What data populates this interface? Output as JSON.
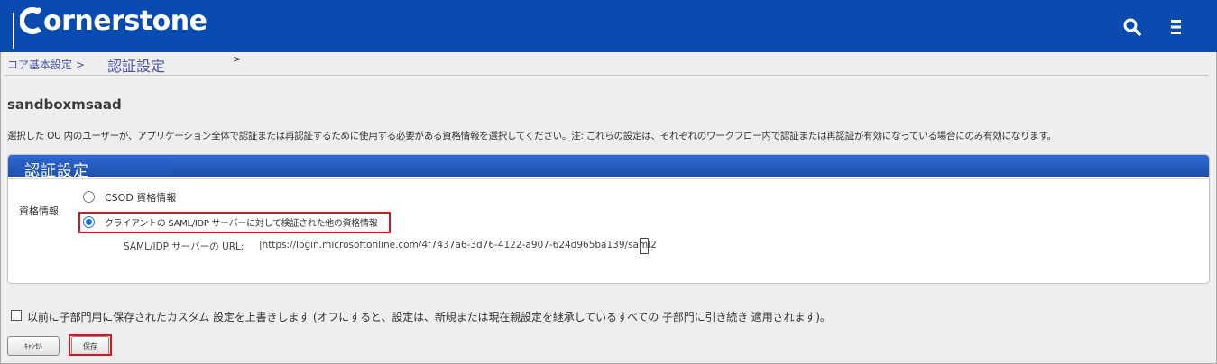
{
  "header": {
    "logo_text": "ornerstone",
    "brand_color": "#0a4bb0",
    "icons": [
      "search-icon",
      "hamburger-menu-icon"
    ]
  },
  "breadcrumb": {
    "parent": "コア基本設定 >",
    "current": "認証設定",
    "separator": ">"
  },
  "page": {
    "ou_name": "sandboxmsaad",
    "description": "選択した OU 内のユーザーが、アプリケーション全体で認証または再認証するために使用する必要がある資格情報を選択してください。注: これらの設定は、それぞれのワークフロー内で認証または再認証が有効になっている場合にのみ有効になります。"
  },
  "panel": {
    "title": "認証設定",
    "field_label": "資格情報",
    "options": [
      {
        "label": "CSOD 資格情報",
        "selected": false
      },
      {
        "label": "クライアントの SAML/IDP サーバーに対して検証された他の資格情報",
        "selected": true
      }
    ],
    "url_label": "SAML/IDP サーバーの URL:",
    "url_value": "|https://login.microsoftonline.com/4f7437a6-3d76-4122-a907-624d965ba139/saml2"
  },
  "footer": {
    "override_label": "以前に子部門用に保存されたカスタム 設定を上書きします (オフにすると、設定は、新規または現在親設定を継承しているすべての 子部門に引き続き 適用されます)。",
    "override_checked": false,
    "cancel_label": "ｷｬﾝｾﾙ",
    "save_label": "保存"
  },
  "colors": {
    "highlight": "#e0101e",
    "link": "#4a54b0",
    "panel_header": "#1b4faa"
  }
}
